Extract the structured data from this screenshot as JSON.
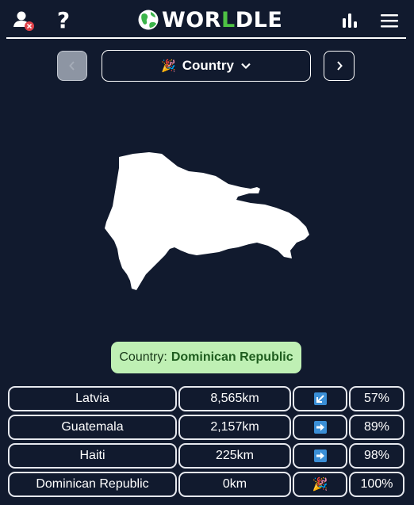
{
  "app": {
    "title_prefix": "WOR",
    "title_accent": "L",
    "title_suffix": "DLE",
    "accent_color": "#4ec244"
  },
  "header": {
    "icons": [
      "user-remove-icon",
      "help-icon",
      "globe-icon",
      "stats-icon",
      "menu-icon"
    ],
    "help_glyph": "?"
  },
  "mode": {
    "emoji": "🎉",
    "label": "Country"
  },
  "answer": {
    "prefix": "Country:",
    "name": "Dominican Republic"
  },
  "guesses": [
    {
      "country": "Latvia",
      "distance": "8,565km",
      "direction": "down-left-arrow",
      "proximity": "57%"
    },
    {
      "country": "Guatemala",
      "distance": "2,157km",
      "direction": "right-arrow",
      "proximity": "89%"
    },
    {
      "country": "Haiti",
      "distance": "225km",
      "direction": "right-arrow",
      "proximity": "98%"
    },
    {
      "country": "Dominican Republic",
      "distance": "0km",
      "direction": "party-popper",
      "proximity": "100%",
      "direction_emoji": "🎉"
    }
  ]
}
